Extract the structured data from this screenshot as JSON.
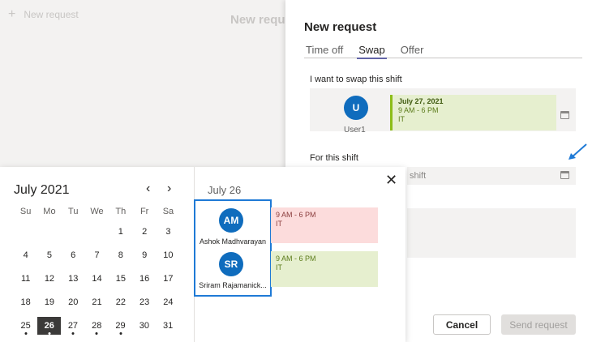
{
  "background": {
    "new_request": "New request",
    "title": "New request"
  },
  "panel": {
    "title": "New request",
    "tabs": [
      "Time off",
      "Swap",
      "Offer"
    ],
    "swap_label": "I want to swap this shift",
    "user": {
      "initial": "U",
      "name": "User1"
    },
    "shift": {
      "date": "July 27, 2021",
      "time": "9 AM - 6 PM",
      "group": "IT"
    },
    "for_label": "For this shift",
    "for_placeholder": "shift",
    "cancel": "Cancel",
    "send": "Send request"
  },
  "calendar": {
    "month": "July 2021",
    "weekdays": [
      "Su",
      "Mo",
      "Tu",
      "We",
      "Th",
      "Fr",
      "Sa"
    ],
    "weeks": [
      [
        "",
        "",
        "",
        "",
        "1",
        "2",
        "3"
      ],
      [
        "4",
        "5",
        "6",
        "7",
        "8",
        "9",
        "10"
      ],
      [
        "11",
        "12",
        "13",
        "14",
        "15",
        "16",
        "17"
      ],
      [
        "18",
        "19",
        "20",
        "21",
        "22",
        "23",
        "24"
      ],
      [
        "25",
        "26",
        "27",
        "28",
        "29",
        "30",
        "31"
      ]
    ],
    "selected": "26",
    "dots": [
      "25",
      "26",
      "27",
      "28",
      "29"
    ]
  },
  "day_view": {
    "date": "July 26",
    "people": [
      {
        "initials": "AM",
        "name": "Ashok Madhvarayan",
        "time": "9 AM - 6 PM",
        "group": "IT"
      },
      {
        "initials": "SR",
        "name": "Sriram Rajamanick...",
        "time": "9 AM - 6 PM",
        "group": "IT"
      }
    ]
  }
}
